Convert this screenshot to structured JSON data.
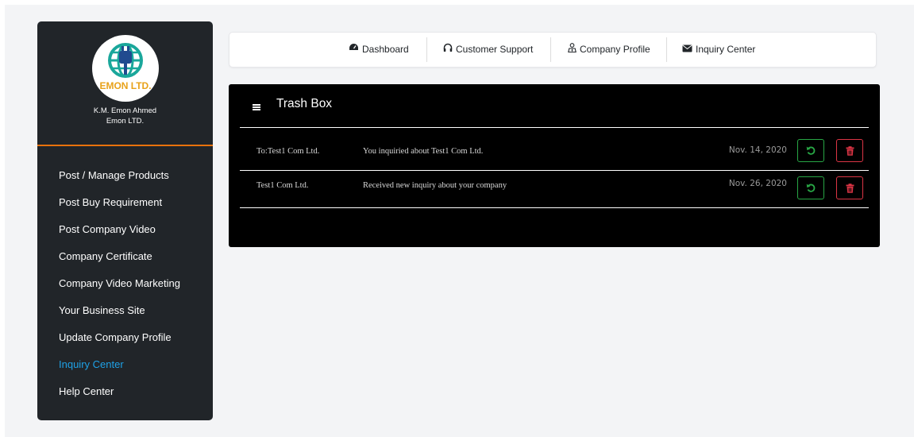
{
  "profile": {
    "logo_text": "EMON LTD.",
    "user_name": "K.M. Emon Ahmed",
    "company": "Emon LTD."
  },
  "sidebar": {
    "items": [
      {
        "label": "Post / Manage Products",
        "active": false
      },
      {
        "label": "Post Buy Requirement",
        "active": false
      },
      {
        "label": "Post Company Video",
        "active": false
      },
      {
        "label": "Company Certificate",
        "active": false
      },
      {
        "label": "Company Video Marketing",
        "active": false
      },
      {
        "label": "Your Business Site",
        "active": false
      },
      {
        "label": "Update Company Profile",
        "active": false
      },
      {
        "label": "Inquiry Center",
        "active": true
      },
      {
        "label": "Help Center",
        "active": false
      }
    ]
  },
  "topnav": {
    "tabs": [
      {
        "label": "Dashboard",
        "icon": "dashboard-icon"
      },
      {
        "label": "Customer Support",
        "icon": "headphones-icon"
      },
      {
        "label": "Company Profile",
        "icon": "user-tie-icon"
      },
      {
        "label": "Inquiry Center",
        "icon": "envelope-icon"
      }
    ]
  },
  "trash": {
    "title": "Trash Box",
    "rows": [
      {
        "to": "To:Test1 Com Ltd.",
        "message": "You inquiried about Test1 Com Ltd.",
        "date": "Nov. 14, 2020"
      },
      {
        "to": "Test1 Com Ltd.",
        "message": "Received new inquiry about your company",
        "date": "Nov. 26, 2020"
      }
    ]
  },
  "colors": {
    "sidebar_bg": "#212529",
    "accent_orange": "#e8720c",
    "active_link": "#1ea1e6",
    "restore_green": "#28a745",
    "delete_red": "#dc3545"
  }
}
